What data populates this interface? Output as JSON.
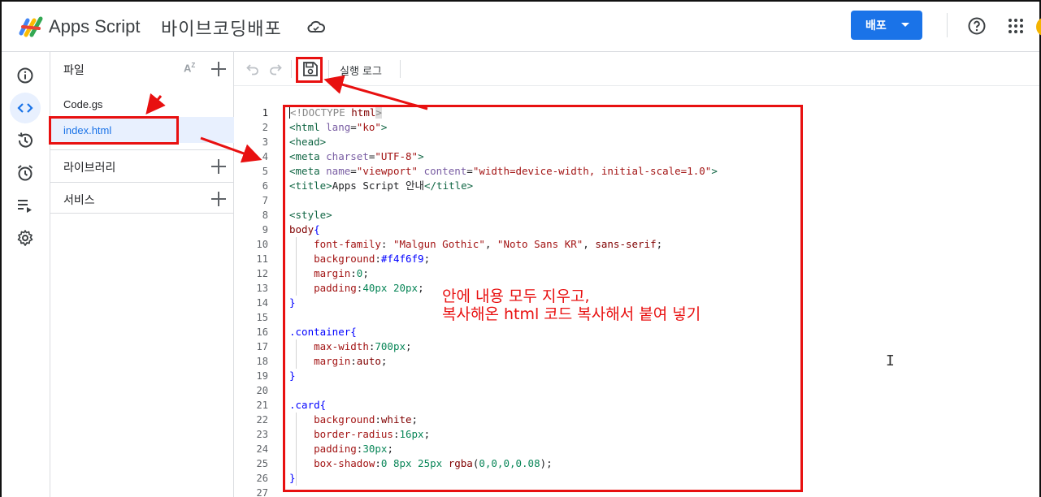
{
  "header": {
    "app_name": "Apps Script",
    "project_name": "바이브코딩배포",
    "deploy_label": "배포"
  },
  "files_panel": {
    "title": "파일",
    "files": [
      "Code.gs",
      "index.html"
    ],
    "libraries_label": "라이브러리",
    "services_label": "서비스"
  },
  "toolbar": {
    "run_log_label": "실행 로그"
  },
  "editor": {
    "line_numbers": [
      "1",
      "2",
      "3",
      "4",
      "5",
      "6",
      "7",
      "8",
      "9",
      "10",
      "11",
      "12",
      "13",
      "14",
      "15",
      "16",
      "17",
      "18",
      "19",
      "20",
      "21",
      "22",
      "23",
      "24",
      "25",
      "26",
      "27"
    ]
  },
  "annotation": {
    "line1": "안에 내용 모두 지우고,",
    "line2": "복사해온 html 코드 복사해서 붙여 넣기",
    "color": "#e81010"
  },
  "colors": {
    "accent": "#1a73e8",
    "selected_bg": "#e8f0fe"
  },
  "icons": [
    "apps-script-logo-icon",
    "cloud-icon",
    "help-icon",
    "apps-grid-icon",
    "info-icon",
    "code-icon",
    "history-icon",
    "alarm-icon",
    "executions-icon",
    "settings-icon",
    "sort-az-icon",
    "add-icon",
    "undo-icon",
    "redo-icon",
    "save-icon"
  ]
}
